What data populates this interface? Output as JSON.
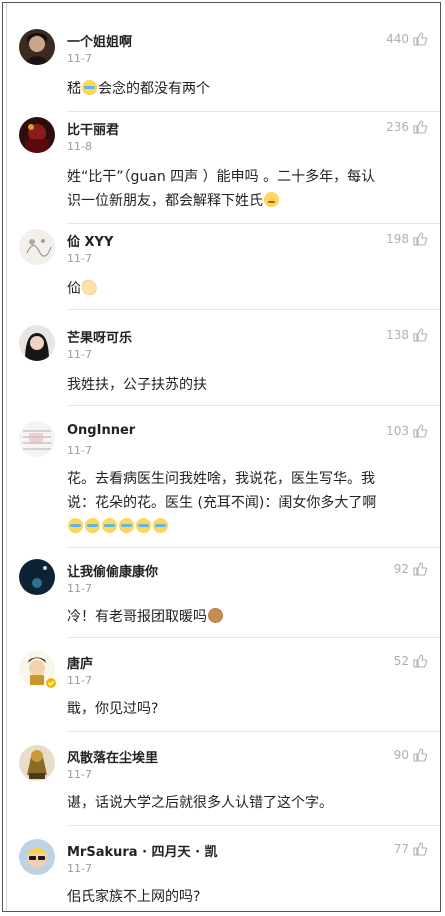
{
  "comments": [
    {
      "name": "一个姐姐啊",
      "date": "11-7",
      "likes": "440",
      "avatar": "avatar-dark-hair",
      "text_parts": [
        "嵇",
        "会念的都没有两个"
      ],
      "emojis": [
        "crying-laughing-emoji"
      ]
    },
    {
      "name": "比干丽君",
      "date": "11-8",
      "likes": "236",
      "avatar": "avatar-red-dark",
      "text_lines": [
        "姓“比干”（guan 四声 ）能申吗 。二十多年，每认",
        "识一位新朋友，都会解释下姓氏"
      ],
      "emojis": [
        "calm-face-emoji"
      ]
    },
    {
      "name": "佡 XYY",
      "date": "11-7",
      "likes": "198",
      "avatar": "avatar-light-sketch",
      "text_parts": [
        "佡"
      ],
      "emojis": [
        "praying-hands-emoji"
      ]
    },
    {
      "name": "芒果呀可乐",
      "date": "11-7",
      "likes": "138",
      "avatar": "avatar-girl-dark",
      "text": "我姓扶，公子扶苏的扶"
    },
    {
      "name": "OngInner",
      "date": "11-7",
      "likes": "103",
      "avatar": "avatar-light-pattern",
      "text_lines": [
        "花。去看病医生问我姓啥，我说花，医生写华。我",
        "说：花朵的花。医生 (充耳不闻)：闺女你多大了啊"
      ],
      "emojis": [
        "crying-laughing-emoji",
        "crying-laughing-emoji",
        "crying-laughing-emoji",
        "crying-laughing-emoji",
        "crying-laughing-emoji",
        "crying-laughing-emoji"
      ]
    },
    {
      "name": "让我偷偷康康你",
      "date": "11-7",
      "likes": "92",
      "avatar": "avatar-night-blue",
      "text_parts": [
        "冷！有老哥报团取暖吗"
      ],
      "emojis": [
        "see-no-evil-monkey-emoji"
      ]
    },
    {
      "name": "唐庐",
      "date": "11-7",
      "likes": "52",
      "avatar": "avatar-cartoon-verified",
      "text": "戢，你见过吗?"
    },
    {
      "name": "风散落在尘埃里",
      "date": "11-7",
      "likes": "90",
      "avatar": "avatar-golden",
      "text": "谌，话说大学之后就很多人认错了这个字。"
    },
    {
      "name": "MrSakura · 四月天 · 凯",
      "date": "11-7",
      "likes": "77",
      "avatar": "avatar-sunglasses",
      "text": "佀氏家族不上网的吗?"
    }
  ],
  "icons": {
    "like": "thumbs-up-icon",
    "verified": "verified-badge-icon"
  },
  "colors": {
    "likes_gray": "#b0b0b0",
    "date_gray": "#9a9a9a",
    "divider": "#e6e6e6"
  }
}
